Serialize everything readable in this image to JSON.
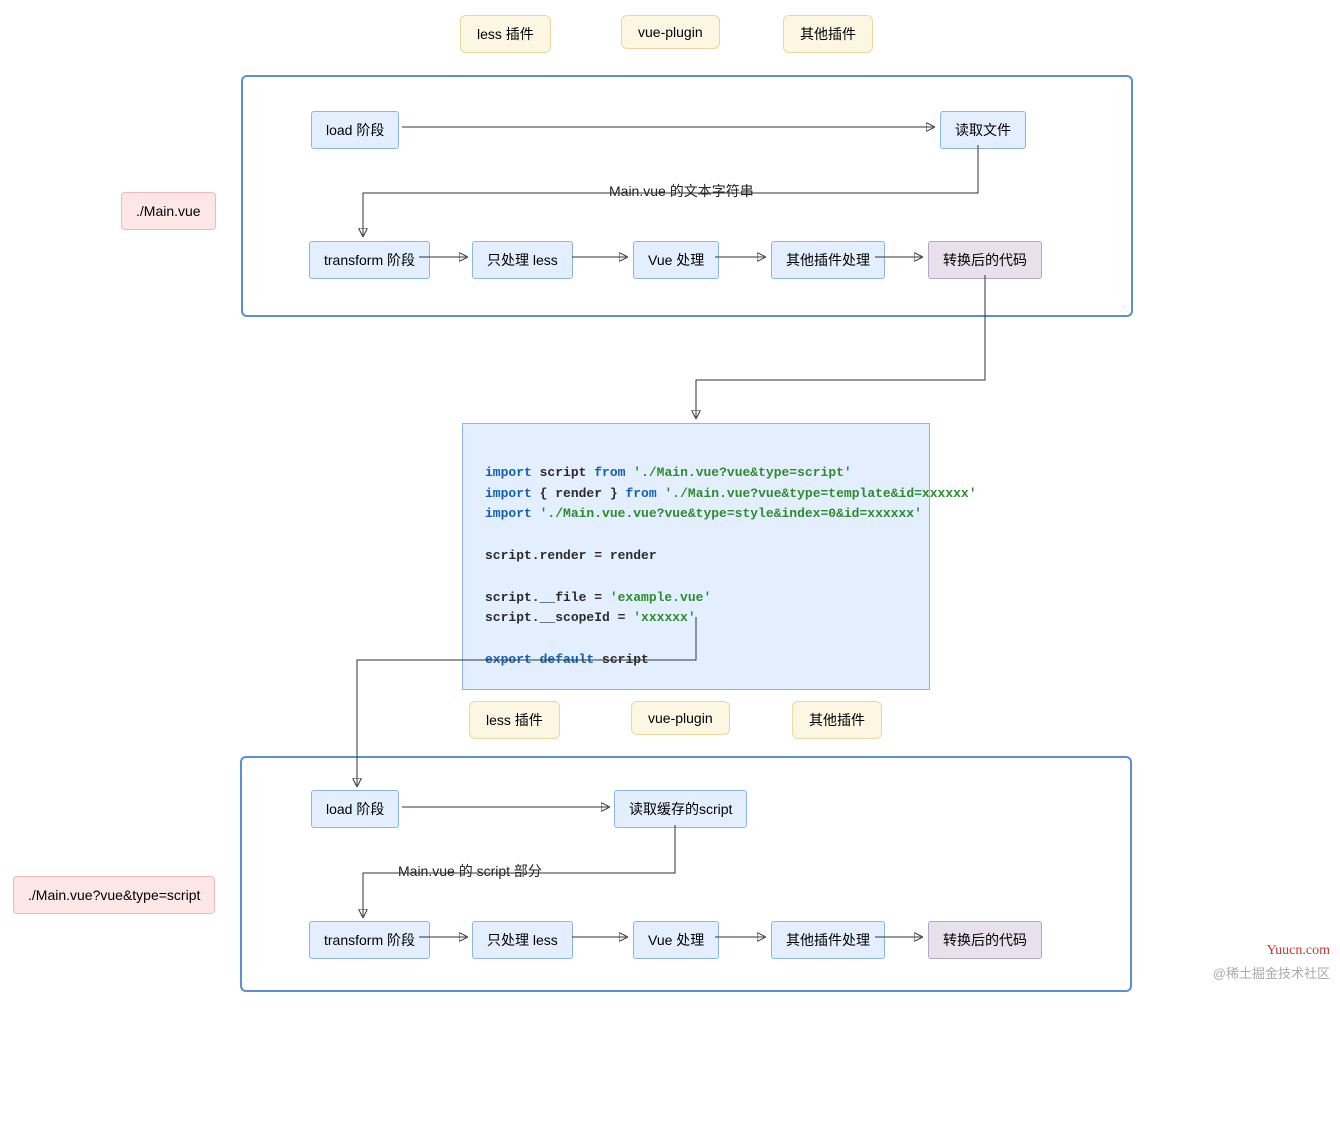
{
  "plugins": {
    "less": "less 插件",
    "vue": "vue-plugin",
    "other": "其他插件"
  },
  "labels": {
    "main_vue": "./Main.vue",
    "main_vue_script": "./Main.vue?vue&type=script"
  },
  "stage1": {
    "load": "load 阶段",
    "read_file": "读取文件",
    "edge1": "Main.vue 的文本字符串",
    "transform": "transform 阶段",
    "only_less": "只处理 less",
    "vue_proc": "Vue 处理",
    "other_proc": "其他插件处理",
    "result": "转换后的代码"
  },
  "code": {
    "line1_a": "import",
    "line1_b": "script",
    "line1_c": "from",
    "line1_d": "'./Main.vue?vue&type=script'",
    "line2_a": "import",
    "line2_b": "{ render }",
    "line2_c": "from",
    "line2_d": "'./Main.vue?vue&type=template&id=xxxxxx'",
    "line3_a": "import",
    "line3_b": "'./Main.vue.vue?vue&type=style&index=0&id=xxxxxx'",
    "line5": "script.render = render",
    "line7": "script.__file = ",
    "line7_b": "'example.vue'",
    "line8": "script.__scopeId = ",
    "line8_b": "'xxxxxx'",
    "line10_a": "export",
    "line10_b": "default",
    "line10_c": "script"
  },
  "stage2": {
    "load": "load 阶段",
    "read_cache": "读取缓存的script",
    "edge1": "Main.vue 的 script 部分",
    "transform": "transform 阶段",
    "only_less": "只处理 less",
    "vue_proc": "Vue 处理",
    "other_proc": "其他插件处理",
    "result": "转换后的代码"
  },
  "watermarks": {
    "yuucn": "Yuucn.com",
    "xitu": "@稀土掘金技术社区"
  }
}
